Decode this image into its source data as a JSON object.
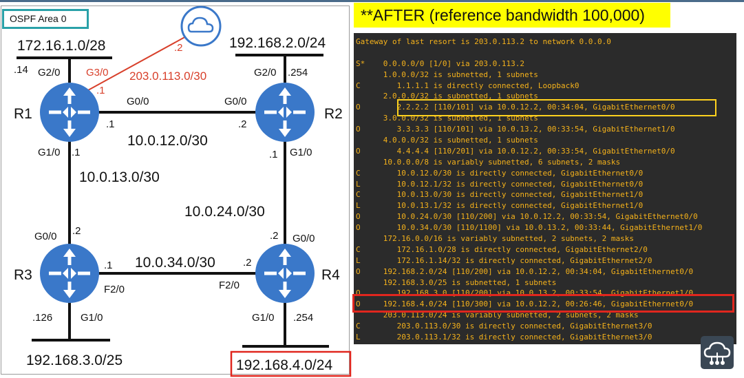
{
  "area_label": "OSPF Area 0",
  "after_title": "**AFTER (reference bandwidth 100,000)",
  "routers": [
    {
      "name": "R1",
      "icon": "router-icon"
    },
    {
      "name": "R2",
      "icon": "router-icon"
    },
    {
      "name": "R3",
      "icon": "router-icon"
    },
    {
      "name": "R4",
      "icon": "router-icon"
    }
  ],
  "internet_icon": "cloud-icon",
  "labels": {
    "net_172": "172.16.1.0/28",
    "net_1922": "192.168.2.0/24",
    "net_1923": "192.168.3.0/25",
    "net_1924": "192.168.4.0/24",
    "net_203": "203.0.113.0/30",
    "net_1012": "10.0.12.0/30",
    "net_1013": "10.0.13.0/30",
    "net_1024": "10.0.24.0/30",
    "net_1034": "10.0.34.0/30",
    "r1_g20": "G2/0",
    "r1_g30": "G3/0",
    "r1_g00": "G0/0",
    "r1_g10": "G1/0",
    "r1_h14": ".14",
    "r1_h1_inet": ".1",
    "r1_h1_r2": ".1",
    "r1_h1_r3": ".1",
    "cloud_h2": ".2",
    "r2_g20": "G2/0",
    "r2_g00": "G0/0",
    "r2_g10": "G1/0",
    "r2_h254": ".254",
    "r2_h2": ".2",
    "r2_h1": ".1",
    "r3_g00": "G0/0",
    "r3_f20": "F2/0",
    "r3_g10": "G1/0",
    "r3_h2": ".2",
    "r3_h1": ".1",
    "r3_h126": ".126",
    "r4_g00": "G0/0",
    "r4_f20": "F2/0",
    "r4_g10": "G1/0",
    "r4_h2_r2": ".2",
    "r4_h2_r3": ".2",
    "r4_h254": ".254"
  },
  "routing_table": [
    "Gateway of last resort is 203.0.113.2 to network 0.0.0.0",
    "",
    "S*    0.0.0.0/0 [1/0] via 203.0.113.2",
    "      1.0.0.0/32 is subnetted, 1 subnets",
    "C        1.1.1.1 is directly connected, Loopback0",
    "      2.0.0.0/32 is subnetted, 1 subnets",
    "O        2.2.2.2 [110/101] via 10.0.12.2, 00:34:04, GigabitEthernet0/0",
    "      3.0.0.0/32 is subnetted, 1 subnets",
    "O        3.3.3.3 [110/101] via 10.0.13.2, 00:33:54, GigabitEthernet1/0",
    "      4.0.0.0/32 is subnetted, 1 subnets",
    "O        4.4.4.4 [110/201] via 10.0.12.2, 00:33:54, GigabitEthernet0/0",
    "      10.0.0.0/8 is variably subnetted, 6 subnets, 2 masks",
    "C        10.0.12.0/30 is directly connected, GigabitEthernet0/0",
    "L        10.0.12.1/32 is directly connected, GigabitEthernet0/0",
    "C        10.0.13.0/30 is directly connected, GigabitEthernet1/0",
    "L        10.0.13.1/32 is directly connected, GigabitEthernet1/0",
    "O        10.0.24.0/30 [110/200] via 10.0.12.2, 00:33:54, GigabitEthernet0/0",
    "O        10.0.34.0/30 [110/1100] via 10.0.13.2, 00:33:44, GigabitEthernet1/0",
    "      172.16.0.0/16 is variably subnetted, 2 subnets, 2 masks",
    "C        172.16.1.0/28 is directly connected, GigabitEthernet2/0",
    "L        172.16.1.14/32 is directly connected, GigabitEthernet2/0",
    "O     192.168.2.0/24 [110/200] via 10.0.12.2, 00:34:04, GigabitEthernet0/0",
    "      192.168.3.0/25 is subnetted, 1 subnets",
    "O        192.168.3.0 [110/200] via 10.0.13.2, 00:33:54, GigabitEthernet1/0",
    "O     192.168.4.0/24 [110/300] via 10.0.12.2, 00:26:46, GigabitEthernet0/0",
    "      203.0.113.0/24 is variably subnetted, 2 subnets, 2 masks",
    "C        203.0.113.0/30 is directly connected, GigabitEthernet3/0",
    "L        203.0.113.1/32 is directly connected, GigabitEthernet3/0"
  ],
  "badge_icon": "cloud-network-icon",
  "colors": {
    "router": "#3a78c9",
    "area_border": "#2aa1a8",
    "inet_link": "#d8402b",
    "title_bg": "#ffff00",
    "cli_bg": "#2b2b2b",
    "cli_text": "#f5b21b",
    "highlight_yellow": "#ffd21e",
    "highlight_red": "#e0261e"
  }
}
